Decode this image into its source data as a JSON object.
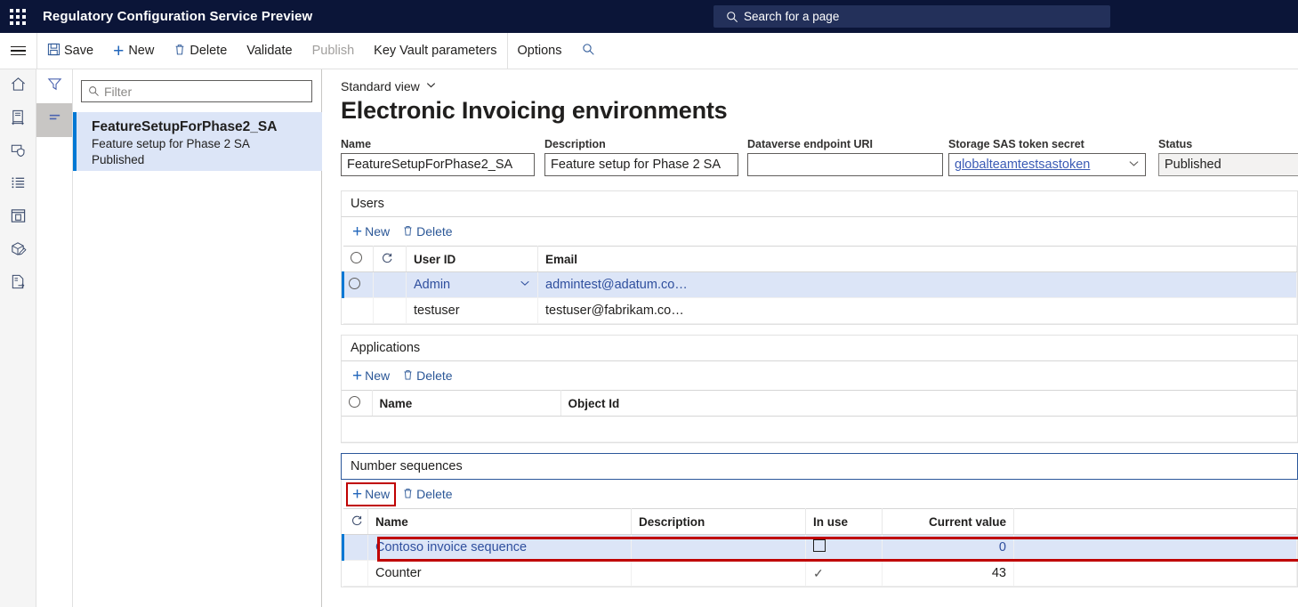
{
  "topbar": {
    "waffle_icon": "app-launcher-icon",
    "app_title": "Regulatory Configuration Service Preview",
    "search_placeholder": "Search for a page",
    "search_value": "",
    "search_icon": "search-icon"
  },
  "commandbar": {
    "menu_icon": "hamburger-icon",
    "buttons": [
      {
        "label": "Save",
        "icon": "save-icon",
        "disabled": false
      },
      {
        "label": "New",
        "icon": "plus-icon",
        "disabled": false
      },
      {
        "label": "Delete",
        "icon": "trash-icon",
        "disabled": false
      },
      {
        "label": "Validate",
        "icon": "",
        "disabled": false
      },
      {
        "label": "Publish",
        "icon": "",
        "disabled": true
      },
      {
        "label": "Key Vault parameters",
        "icon": "",
        "disabled": false
      },
      {
        "label": "Options",
        "icon": "",
        "disabled": false
      }
    ],
    "search_icon": "search-icon"
  },
  "navrail": {
    "items": [
      {
        "icon": "home-icon",
        "name": "home"
      },
      {
        "icon": "document-exchange-icon",
        "name": "data-exchange"
      },
      {
        "icon": "shield-monitor-icon",
        "name": "security"
      },
      {
        "icon": "bullet-list-icon",
        "name": "list"
      },
      {
        "icon": "window-document-icon",
        "name": "reports"
      },
      {
        "icon": "package-edit-icon",
        "name": "package"
      },
      {
        "icon": "document-export-icon",
        "name": "export"
      }
    ]
  },
  "listpanel": {
    "tabs": [
      {
        "icon": "filter-icon",
        "name": "filter",
        "active": false
      },
      {
        "icon": "lines-icon",
        "name": "list-view",
        "active": true
      }
    ],
    "filter_placeholder": "Filter",
    "filter_value": "",
    "filter_icon": "search-icon",
    "items": [
      {
        "name": "FeatureSetupForPhase2_SA",
        "description": "Feature setup for Phase 2 SA",
        "status": "Published",
        "selected": true
      }
    ]
  },
  "main": {
    "view_selector": "Standard view",
    "view_selector_icon": "chevron-down-icon",
    "page_title": "Electronic Invoicing environments",
    "header_fields": [
      {
        "label": "Name",
        "value": "FeatureSetupForPhase2_SA",
        "type": "text"
      },
      {
        "label": "Description",
        "value": "Feature setup for Phase 2 SA",
        "type": "text"
      },
      {
        "label": "Dataverse endpoint URI",
        "value": "",
        "type": "text"
      },
      {
        "label": "Storage SAS token secret",
        "value": "globalteamtestsastoken",
        "type": "combo"
      },
      {
        "label": "Status",
        "value": "Published",
        "type": "readonly"
      }
    ],
    "sections": [
      {
        "id": "users",
        "title": "Users",
        "focused": false,
        "toolbar": [
          {
            "label": "New",
            "icon": "plus-icon",
            "highlight": false
          },
          {
            "label": "Delete",
            "icon": "trash-icon",
            "highlight": false
          }
        ],
        "columns": [
          "",
          "",
          "User ID",
          "Email"
        ],
        "rows": [
          {
            "user_id": "Admin",
            "email": "admintest@adatum.co…",
            "selected": true
          },
          {
            "user_id": "testuser",
            "email": "testuser@fabrikam.co…",
            "selected": false
          }
        ]
      },
      {
        "id": "applications",
        "title": "Applications",
        "focused": false,
        "toolbar": [
          {
            "label": "New",
            "icon": "plus-icon",
            "highlight": false
          },
          {
            "label": "Delete",
            "icon": "trash-icon",
            "highlight": false
          }
        ],
        "columns": [
          "",
          "Name",
          "Object Id"
        ],
        "rows": []
      },
      {
        "id": "number-sequences",
        "title": "Number sequences",
        "focused": true,
        "toolbar": [
          {
            "label": "New",
            "icon": "plus-icon",
            "highlight": true
          },
          {
            "label": "Delete",
            "icon": "trash-icon",
            "highlight": false
          }
        ],
        "columns": [
          "",
          "Name",
          "Description",
          "In use",
          "Current value"
        ],
        "rows": [
          {
            "name": "Contoso invoice sequence",
            "description": "",
            "in_use": false,
            "current_value": "0",
            "selected": true,
            "highlighted": true
          },
          {
            "name": "Counter",
            "description": "",
            "in_use": true,
            "current_value": "43",
            "selected": false,
            "highlighted": false
          }
        ]
      }
    ]
  },
  "colors": {
    "topbar_bg": "#0b1538",
    "accent": "#0078d4",
    "link": "#2b5797",
    "selection_row": "#dce5f7",
    "highlight_red": "#c00000",
    "section_focus_border": "#2b579a"
  }
}
